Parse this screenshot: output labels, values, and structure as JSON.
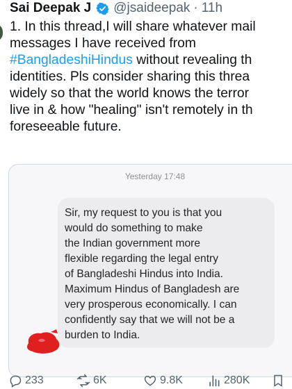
{
  "tweet": {
    "author_name": "Sai Deepak J",
    "handle": "@jsaideepak",
    "separator": "·",
    "time_ago": "11h",
    "lines": [
      {
        "before": "1. In this thread,I will share whatever mail",
        "hashtag": "",
        "after": ""
      },
      {
        "before": "messages I have received from",
        "hashtag": "",
        "after": ""
      },
      {
        "before": "",
        "hashtag": "#BangladeshiHindus",
        "after": " without revealing th"
      },
      {
        "before": "identities. Pls consider sharing this threa",
        "hashtag": "",
        "after": ""
      },
      {
        "before": "widely so that the world knows the terror",
        "hashtag": "",
        "after": ""
      },
      {
        "before": "live in & how \"healing\" isn't remotely in th",
        "hashtag": "",
        "after": ""
      },
      {
        "before": "foreseeable future.",
        "hashtag": "",
        "after": ""
      }
    ]
  },
  "media": {
    "timestamp": "Yesterday 17:48",
    "message_lines": [
      "Sir, my request to you is that you",
      "would do something to make",
      "the Indian government more",
      "flexible regarding the legal entry",
      "of Bangladeshi Hindus into India.",
      "Maximum Hindus of Bangladesh are",
      "very prosperous economically.  I can",
      "confidently say that we will not be a",
      "burden to India."
    ]
  },
  "actions": {
    "replies": "233",
    "reposts": "6K",
    "likes": "9.8K",
    "views": "280K"
  },
  "colors": {
    "link": "#1d9bf0",
    "muted": "#536471",
    "redaction": "#e02020"
  }
}
